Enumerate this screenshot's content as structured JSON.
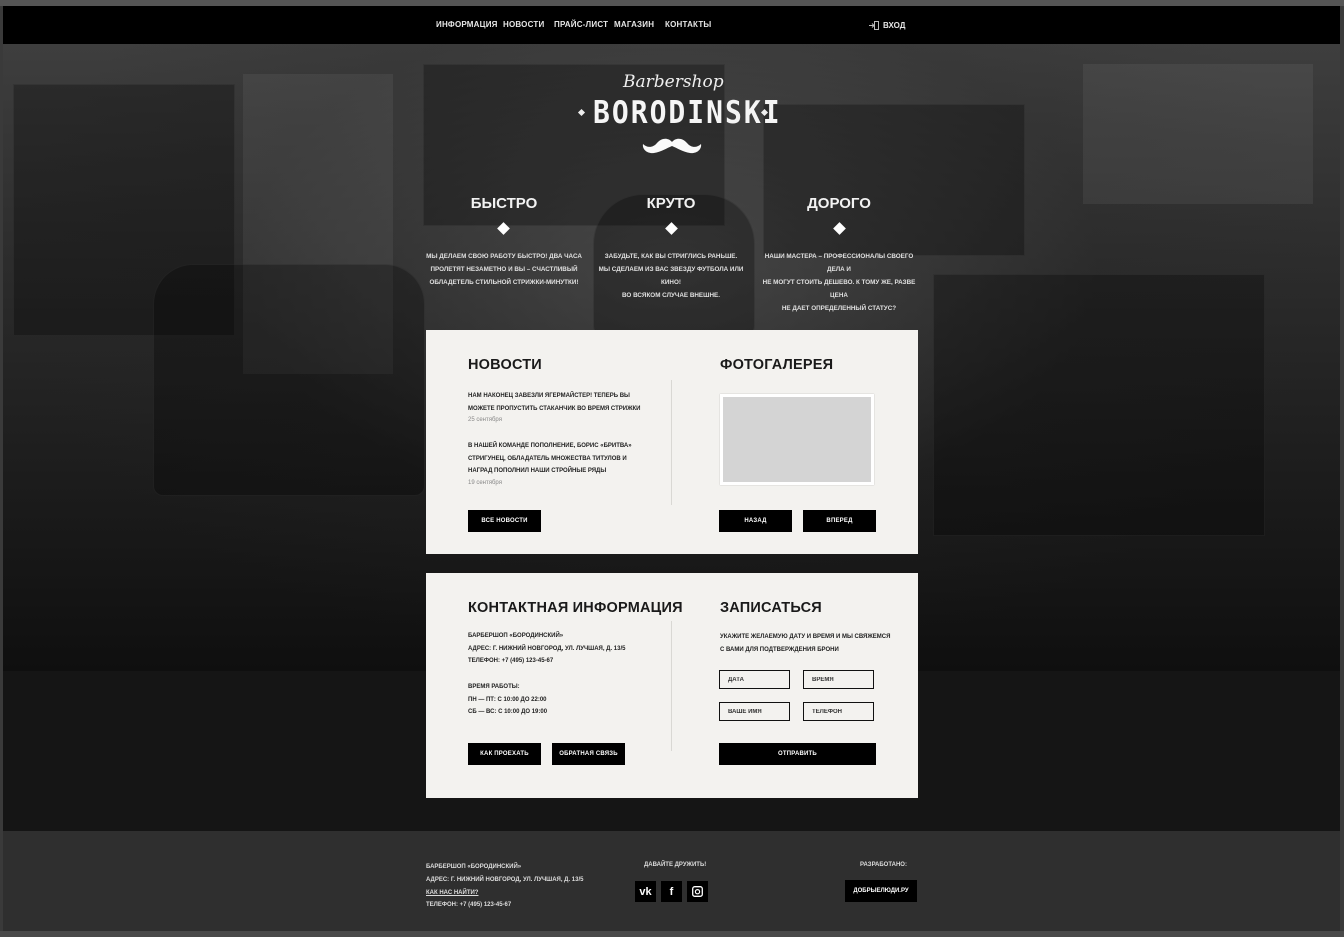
{
  "nav": {
    "items": [
      "ИНФОРМАЦИЯ",
      "НОВОСТИ",
      "ПРАЙС-ЛИСТ",
      "МАГАЗИН",
      "КОНТАКТЫ"
    ],
    "login": "ВХОД"
  },
  "logo": {
    "script": "Barbershop",
    "name": "BORODINSKI"
  },
  "features": [
    {
      "title": "БЫСТРО",
      "lines": [
        "МЫ ДЕЛАЕМ СВОЮ РАБОТУ БЫСТРО! ДВА ЧАСА",
        "ПРОЛЕТЯТ НЕЗАМЕТНО И ВЫ – СЧАСТЛИВЫЙ",
        "ОБЛАДЕТЕЛЬ СТИЛЬНОЙ СТРИЖКИ-МИНУТКИ!"
      ]
    },
    {
      "title": "КРУТО",
      "lines": [
        "ЗАБУДЬТЕ, КАК ВЫ СТРИГЛИСЬ РАНЬШЕ.",
        "МЫ СДЕЛАЕМ ИЗ ВАС ЗВЕЗДУ ФУТБОЛА ИЛИ КИНО!",
        "ВО ВСЯКОМ СЛУЧАЕ ВНЕШНЕ."
      ]
    },
    {
      "title": "ДОРОГО",
      "lines": [
        "НАШИ МАСТЕРА – ПРОФЕССИОНАЛЫ СВОЕГО ДЕЛА И",
        "НЕ МОГУТ СТОИТЬ ДЕШЕВО. К ТОМУ ЖЕ, РАЗВЕ ЦЕНА",
        "НЕ ДАЕТ ОПРЕДЕЛЕННЫЙ СТАТУС?"
      ]
    }
  ],
  "news": {
    "title": "НОВОСТИ",
    "items": [
      {
        "lines": [
          "НАМ НАКОНЕЦ ЗАВЕЗЛИ ЯГЕРМАЙСТЕР! ТЕПЕРЬ ВЫ",
          "МОЖЕТЕ ПРОПУСТИТЬ СТАКАНЧИК ВО ВРЕМЯ СТРИЖКИ"
        ],
        "date": "25 сентября"
      },
      {
        "lines": [
          "В НАШЕЙ КОМАНДЕ ПОПОЛНЕНИЕ, БОРИС «БРИТВА»",
          "СТРИГУНЕЦ, ОБЛАДАТЕЛЬ МНОЖЕСТВА ТИТУЛОВ И",
          "НАГРАД ПОПОЛНИЛ НАШИ СТРОЙНЫЕ РЯДЫ"
        ],
        "date": "19 сентября"
      }
    ],
    "button": "ВСЕ НОВОСТИ"
  },
  "gallery": {
    "title": "ФОТОГАЛЕРЕЯ",
    "prev": "НАЗАД",
    "next": "ВПЕРЕД"
  },
  "contacts": {
    "title": "КОНТАКТНАЯ ИНФОРМАЦИЯ",
    "lines": [
      "БАРБЕРШОП «БОРОДИНСКИЙ»",
      "АДРЕС: Г. НИЖНИЙ НОВГОРОД, УЛ. ЛУЧШАЯ, Д. 13/5",
      "ТЕЛЕФОН: +7 (495) 123-45-67"
    ],
    "hours": [
      "ВРЕМЯ РАБОТЫ:",
      "ПН — ПТ: С 10:00 ДО 22:00",
      "СБ — ВС: С 10:00 ДО 19:00"
    ],
    "route_button": "КАК ПРОЕХАТЬ",
    "feedback_button": "ОБРАТНАЯ СВЯЗЬ"
  },
  "booking": {
    "title": "ЗАПИСАТЬСЯ",
    "lines": [
      "УКАЖИТЕ ЖЕЛАЕМУЮ ДАТУ И ВРЕМЯ И МЫ СВЯЖЕМСЯ",
      "С ВАМИ ДЛЯ ПОДТВЕРЖДЕНИЯ БРОНИ"
    ],
    "date_placeholder": "ДАТА",
    "time_placeholder": "ВРЕМЯ",
    "name_placeholder": "ВАШЕ ИМЯ",
    "phone_placeholder": "ТЕЛЕФОН",
    "submit": "ОТПРАВИТЬ"
  },
  "footer": {
    "lines": [
      "БАРБЕРШОП «БОРОДИНСКИЙ»",
      "АДРЕС: Г. НИЖНИЙ НОВГОРОД, УЛ. ЛУЧШАЯ, Д. 13/5"
    ],
    "find_link": "КАК НАС НАЙТИ?",
    "phone": "ТЕЛЕФОН: +7 (495) 123-45-67",
    "social_title": "ДАВАЙТЕ ДРУЖИТЬ!",
    "social": [
      {
        "icon": "vk-icon",
        "glyph": "vk"
      },
      {
        "icon": "facebook-icon",
        "glyph": "f"
      },
      {
        "icon": "instagram-icon",
        "glyph": ""
      }
    ],
    "dev_title": "РАЗРАБОТАНО:",
    "dev_button": "ДОБРЫЕЛЮДИ.РУ"
  }
}
